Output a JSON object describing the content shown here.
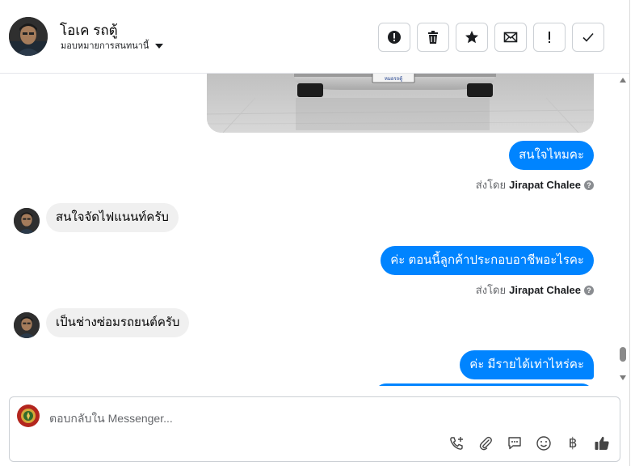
{
  "header": {
    "contact_name": "โอเค รถตู้",
    "assign_label": "มอบหมายการสนทนานี้",
    "actions": [
      {
        "icon": "report-circle-icon"
      },
      {
        "icon": "trash-icon"
      },
      {
        "icon": "star-icon"
      },
      {
        "icon": "envelope-icon"
      },
      {
        "icon": "exclamation-icon"
      },
      {
        "icon": "checkmark-icon"
      }
    ]
  },
  "conversation": {
    "car_plate_text": "หมอรถตู้",
    "messages": [
      {
        "direction": "out",
        "text": "สนใจไหมคะ",
        "sent_by_label": "ส่งโดย",
        "sent_by_name": "Jirapat Chalee"
      },
      {
        "direction": "in",
        "text": "สนใจจัดไฟแนนท์ครับ"
      },
      {
        "direction": "out",
        "text": "ค่ะ ตอนนี้ลูกค้าประกอบอาชีพอะไรคะ",
        "sent_by_label": "ส่งโดย",
        "sent_by_name": "Jirapat Chalee"
      },
      {
        "direction": "in",
        "text": "เป็นช่างซ่อมรถยนต์ครับ"
      },
      {
        "direction": "out",
        "text": "ค่ะ มีรายได้เท่าไหร่คะ"
      }
    ],
    "help_glyph": "?"
  },
  "composer": {
    "placeholder": "ตอบกลับใน Messenger...",
    "tools": [
      "phone-plus-icon",
      "paperclip-icon",
      "chat-bubble-icon",
      "smiley-icon",
      "baht-icon",
      "thumbs-up-icon"
    ],
    "baht_symbol": "฿"
  },
  "colors": {
    "outgoing_bubble": "#0084ff",
    "incoming_bubble": "#f0f0f0",
    "composer_logo": "#b3261e"
  }
}
